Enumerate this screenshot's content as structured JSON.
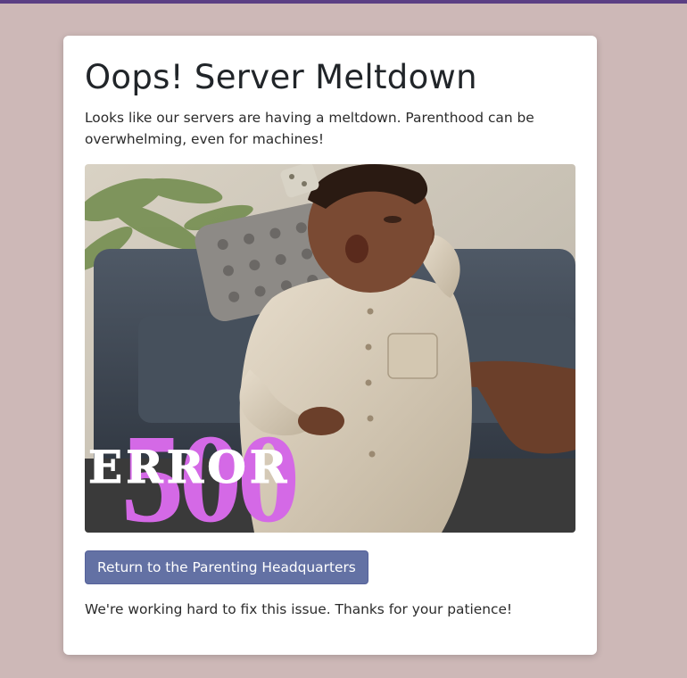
{
  "page": {
    "title": "Oops! Server Meltdown",
    "message": "Looks like our servers are having a meltdown. Parenthood can be overwhelming, even for machines!",
    "hero_image": {
      "overlay_word": "ERROR",
      "overlay_code": "500"
    },
    "return_button_label": "Return to the Parenting Headquarters",
    "footer_note": "We're working hard to fix this issue. Thanks for your patience!"
  },
  "colors": {
    "top_bar": "#5b3f84",
    "background": "#cdb8b7",
    "button": "#6371a4",
    "code_overlay": "#d469e6"
  }
}
